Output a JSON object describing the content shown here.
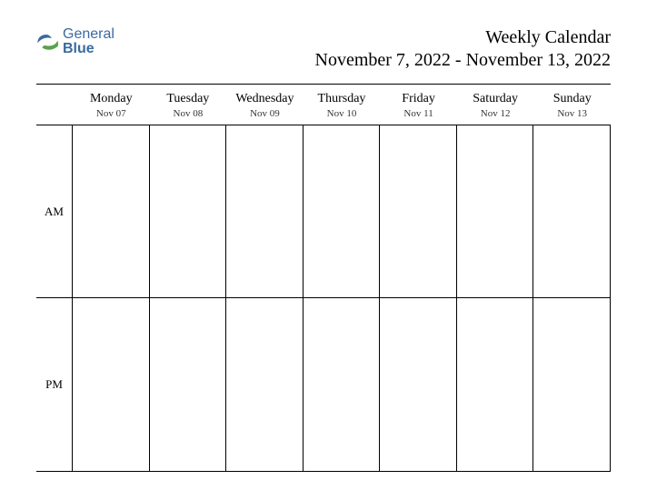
{
  "logo": {
    "text_general": "General",
    "text_blue": "Blue"
  },
  "header": {
    "title": "Weekly Calendar",
    "date_range": "November 7, 2022 - November 13, 2022"
  },
  "days": [
    {
      "name": "Monday",
      "date": "Nov 07"
    },
    {
      "name": "Tuesday",
      "date": "Nov 08"
    },
    {
      "name": "Wednesday",
      "date": "Nov 09"
    },
    {
      "name": "Thursday",
      "date": "Nov 10"
    },
    {
      "name": "Friday",
      "date": "Nov 11"
    },
    {
      "name": "Saturday",
      "date": "Nov 12"
    },
    {
      "name": "Sunday",
      "date": "Nov 13"
    }
  ],
  "periods": {
    "am": "AM",
    "pm": "PM"
  }
}
